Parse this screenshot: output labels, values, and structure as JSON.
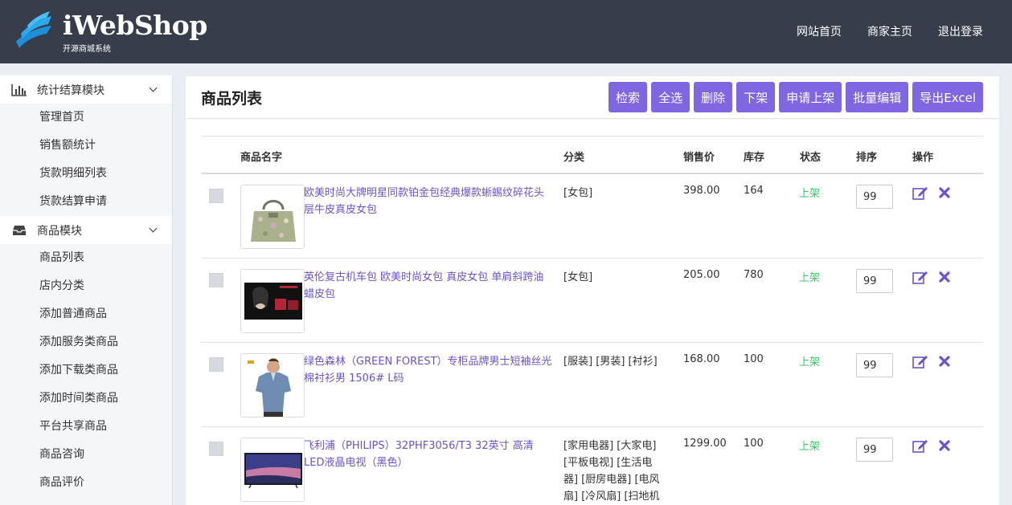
{
  "header": {
    "logo_title": "iWebShop",
    "logo_subtitle": "开源商城系统",
    "nav": [
      "网站首页",
      "商家主页",
      "退出登录"
    ]
  },
  "sidebar": {
    "groups": [
      {
        "label": "统计结算模块",
        "icon": "bar-chart-icon",
        "items": [
          "管理首页",
          "销售额统计",
          "货款明细列表",
          "货款结算申请"
        ]
      },
      {
        "label": "商品模块",
        "icon": "inbox-icon",
        "items": [
          "商品列表",
          "店内分类",
          "添加普通商品",
          "添加服务类商品",
          "添加下载类商品",
          "添加时间类商品",
          "平台共享商品",
          "商品咨询",
          "商品评价"
        ]
      }
    ]
  },
  "main": {
    "title": "商品列表",
    "toolbar": [
      "检索",
      "全选",
      "删除",
      "下架",
      "申请上架",
      "批量编辑",
      "导出Excel"
    ],
    "columns": {
      "name": "商品名字",
      "category": "分类",
      "price": "销售价",
      "stock": "库存",
      "status": "状态",
      "sort": "排序",
      "actions": "操作"
    },
    "rows": [
      {
        "name": "欧美时尚大牌明星同款铂金包经典爆款蜥蜴纹碎花头层牛皮真皮女包",
        "category": "[女包]",
        "price": "398.00",
        "stock": "164",
        "status": "上架",
        "sort": "99",
        "thumb": "handbag"
      },
      {
        "name": "英伦复古机车包 欧美时尚女包 真皮女包 单肩斜跨油蜡皮包",
        "category": "[女包]",
        "price": "205.00",
        "stock": "780",
        "status": "上架",
        "sort": "99",
        "thumb": "bag-ad"
      },
      {
        "name": "绿色森林（GREEN FOREST）专柜品牌男士短袖丝光棉衬衫男 1506# L码",
        "category": "[服装] [男装] [衬衫]",
        "price": "168.00",
        "stock": "100",
        "status": "上架",
        "sort": "99",
        "thumb": "shirt"
      },
      {
        "name": "飞利浦（PHILIPS）32PHF3056/T3 32英寸 高清LED液晶电视（黑色）",
        "category": "[家用电器] [大家电] [平板电视] [生活电器] [厨房电器] [电风扇] [冷风扇] [扫地机",
        "price": "1299.00",
        "stock": "100",
        "status": "上架",
        "sort": "99",
        "thumb": "tv"
      }
    ]
  },
  "colors": {
    "header_bg": "#373d4a",
    "accent": "#8067e2",
    "link": "#6a53c9",
    "status_on": "#3bc66a"
  }
}
